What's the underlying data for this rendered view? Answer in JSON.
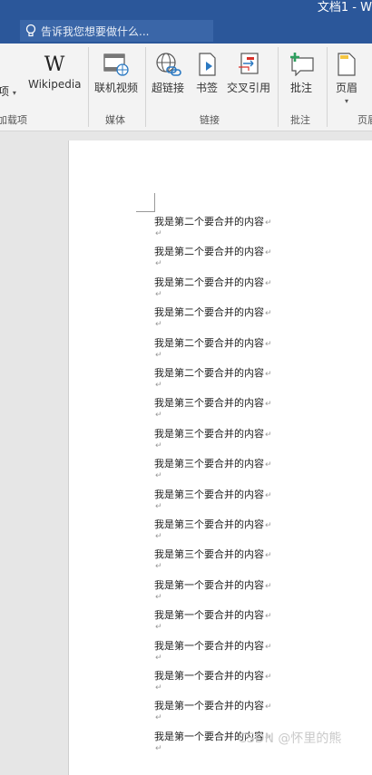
{
  "window": {
    "title": "文档1 - W"
  },
  "tell_me": {
    "placeholder": "告诉我您想要做什么..."
  },
  "ribbon": {
    "partial_left_label": "项",
    "partial_left_group": "加载项",
    "buttons": {
      "wikipedia": "Wikipedia",
      "online_video": "联机视频",
      "hyperlink": "超链接",
      "bookmark": "书签",
      "cross_reference": "交叉引用",
      "comment": "批注",
      "header": "页眉"
    },
    "groups": {
      "media": "媒体",
      "links": "链接",
      "comments": "批注",
      "header_footer": "页眉"
    }
  },
  "document": {
    "paragraph_mark": "↵",
    "lines": [
      "我是第二个要合并的内容",
      "我是第二个要合并的内容",
      "我是第二个要合并的内容",
      "我是第二个要合并的内容",
      "我是第二个要合并的内容",
      "我是第二个要合并的内容",
      "我是第三个要合并的内容",
      "我是第三个要合并的内容",
      "我是第三个要合并的内容",
      "我是第三个要合并的内容",
      "我是第三个要合并的内容",
      "我是第三个要合并的内容",
      "我是第一个要合并的内容",
      "我是第一个要合并的内容",
      "我是第一个要合并的内容",
      "我是第一个要合并的内容",
      "我是第一个要合并的内容",
      "我是第一个要合并的内容"
    ]
  },
  "watermark": "CSDN @怀里的熊"
}
